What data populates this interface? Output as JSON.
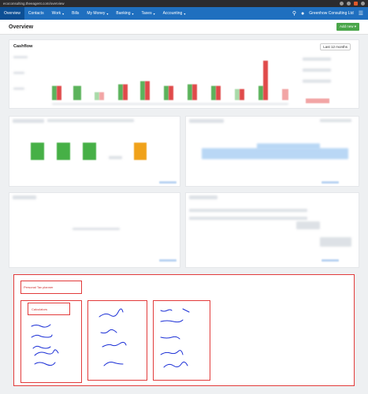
{
  "browser": {
    "url": "ecoconsulting.theeagent.com/overview"
  },
  "nav": {
    "items": [
      {
        "label": "Overview",
        "active": true
      },
      {
        "label": "Contacts"
      },
      {
        "label": "Work",
        "caret": true
      },
      {
        "label": "Bills"
      },
      {
        "label": "My Money",
        "caret": true
      },
      {
        "label": "Banking",
        "caret": true
      },
      {
        "label": "Taxes",
        "caret": true
      },
      {
        "label": "Accounting",
        "caret": true
      }
    ],
    "org": "Greenhow Consulting Ltd",
    "caret": "▾"
  },
  "header": {
    "title": "Overview",
    "add_new": "Add new ▾"
  },
  "cashflow": {
    "title": "Cashflow",
    "period": "Last 12 months"
  },
  "annotations": {
    "personal_tax": "Personal Tax planner",
    "calculators": "Calculators"
  },
  "colors": {
    "nav": "#1f6fbf",
    "nav_active": "#0d4f94",
    "accent_green": "#4aa64a",
    "annotation_red": "#e23b3b",
    "scribble_blue": "#1b2fd6"
  }
}
